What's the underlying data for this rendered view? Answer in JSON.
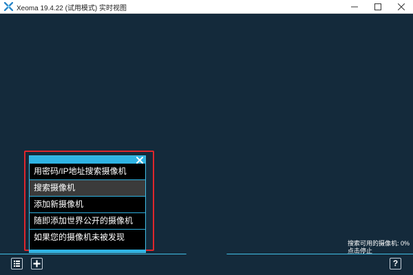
{
  "window": {
    "title": "Xeoma 19.4.22 (试用模式) 实时视图",
    "controls": [
      "minimize",
      "maximize",
      "close"
    ]
  },
  "colors": {
    "background": "#142a3b",
    "accent": "#2fb3e3",
    "highlight_border": "#e0262c",
    "menu_bg": "#000000",
    "selected_item": "#3b3b3b"
  },
  "menu": {
    "close_icon": "close-icon",
    "items": [
      {
        "label": "用密码/IP地址搜索摄像机"
      },
      {
        "label": "搜索摄像机"
      },
      {
        "label": "添加新摄像机"
      },
      {
        "label": "随即添加世界公开的摄像机"
      },
      {
        "label": "如果您的摄像机未被发现"
      }
    ],
    "selected_index": 1
  },
  "status": {
    "line1": "搜索可用的摄像机: 0%",
    "line2": "点击停止"
  },
  "toolbar": {
    "list_icon": "list-icon",
    "add_icon": "plus-icon",
    "help_label": "?"
  }
}
